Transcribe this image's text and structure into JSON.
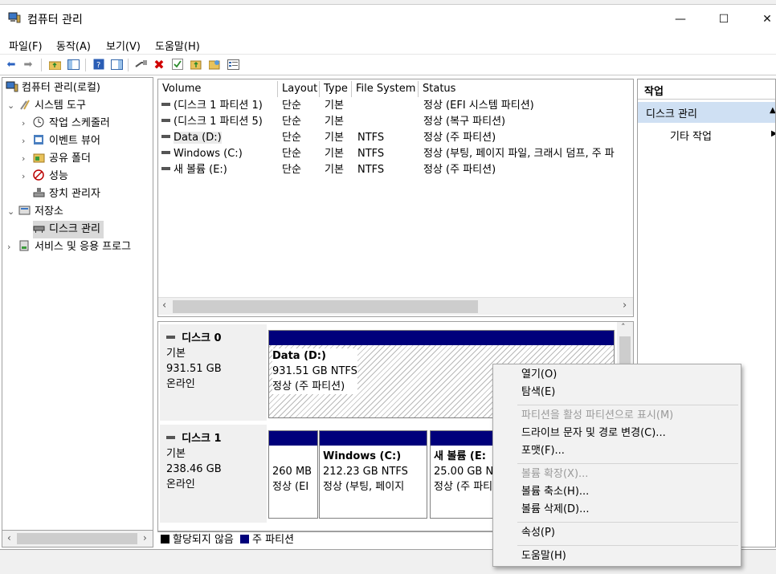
{
  "window": {
    "title": "컴퓨터 관리",
    "minimize": "—",
    "maximize": "☐",
    "close": "✕"
  },
  "menu": [
    "파일(F)",
    "동작(A)",
    "보기(V)",
    "도움말(H)"
  ],
  "tree": {
    "root": "컴퓨터 관리(로컬)",
    "system_tools": "시스템 도구",
    "task_scheduler": "작업 스케줄러",
    "event_viewer": "이벤트 뷰어",
    "shared_folders": "공유 폴더",
    "performance": "성능",
    "device_manager": "장치 관리자",
    "storage": "저장소",
    "disk_management": "디스크 관리",
    "services": "서비스 및 응용 프로그"
  },
  "volumes": {
    "headers": [
      "Volume",
      "Layout",
      "Type",
      "File System",
      "Status"
    ],
    "rows": [
      [
        "(디스크 1 파티션 1)",
        "단순",
        "기본",
        "",
        "정상 (EFI 시스템 파티션)"
      ],
      [
        "(디스크 1 파티션 5)",
        "단순",
        "기본",
        "",
        "정상 (복구 파티션)"
      ],
      [
        "Data (D:)",
        "단순",
        "기본",
        "NTFS",
        "정상 (주 파티션)"
      ],
      [
        "Windows (C:)",
        "단순",
        "기본",
        "NTFS",
        "정상 (부팅, 페이지 파일, 크래시 덤프, 주 파"
      ],
      [
        "새 볼륨 (E:)",
        "단순",
        "기본",
        "NTFS",
        "정상 (주 파티션)"
      ]
    ]
  },
  "disks": [
    {
      "name": "디스크 0",
      "type": "기본",
      "size": "931.51 GB",
      "state": "온라인",
      "partitions": [
        {
          "title": "Data  (D:)",
          "size": "931.51 GB NTFS",
          "status": "정상 (주 파티션)"
        }
      ]
    },
    {
      "name": "디스크 1",
      "type": "기본",
      "size": "238.46 GB",
      "state": "온라인",
      "partitions": [
        {
          "title": "",
          "size": "260 MB",
          "status": "정상 (EI"
        },
        {
          "title": "Windows  (C:)",
          "size": "212.23 GB NTFS",
          "status": "정상 (부팅, 페이지"
        },
        {
          "title": "새 볼륨  (E:",
          "size": "25.00 GB N",
          "status": "정상 (주 파티"
        }
      ]
    }
  ],
  "legend": {
    "unallocated": "할당되지 않음",
    "primary": "주 파티션",
    "unallocated_color": "#000000",
    "primary_color": "#00007b"
  },
  "actions": {
    "header": "작업",
    "selected": "디스크 관리",
    "more": "기타 작업"
  },
  "context_menu": {
    "open": "열기(O)",
    "explore": "탐색(E)",
    "mark_active": "파티션을 활성 파티션으로 표시(M)",
    "change_letter": "드라이브 문자 및 경로 변경(C)...",
    "format": "포맷(F)...",
    "extend": "볼륨 확장(X)...",
    "shrink": "볼륨 축소(H)...",
    "delete": "볼륨 삭제(D)...",
    "properties": "속성(P)",
    "help": "도움말(H)"
  }
}
